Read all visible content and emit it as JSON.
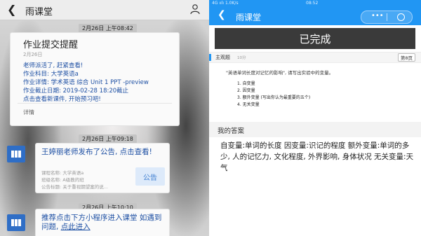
{
  "left": {
    "title": "雨课堂",
    "timestamps": [
      "2月26日 上午08:42",
      "2月26日 上午09:18",
      "2月26日 上午10:10"
    ],
    "reminder": {
      "title": "作业提交提醒",
      "date": "2月26日",
      "lines": [
        "老师派活了, 赶紧查看!",
        "作业科目: 大学英语a",
        "作业详情: 学术英语 综合 Unit 1 PPT -preview",
        "作业截止日期: 2019-02-28 18:20截止",
        "点击查看新课件, 开始预习吧!"
      ],
      "detail": "详情"
    },
    "announcement": {
      "title": "王婷丽老师发布了公告, 点击查看!",
      "lines": [
        "课程名称: 大学英语a",
        "班级名称: A级教的班",
        "公告标题: 关于重视期望案的说..."
      ],
      "badge": "公告"
    },
    "miniprogram": {
      "title": "推荐点击下方小程序进入课堂 如遇到问题,",
      "link": "点此进入"
    }
  },
  "right": {
    "status_left": "4G ıılı 1.0K/s",
    "status_right": "08:52",
    "title": "雨课堂",
    "completed": "已完成",
    "question_type": "主观题",
    "score": "10分",
    "question_number": "第8页",
    "question_text": "\"英语单词长度对记忆的影响\", 请写出实验中的变量。",
    "options": [
      "1. 自变量",
      "2. 因变量",
      "3. 额外变量 (写出你认为最重要的五个)",
      "4. 无关变量"
    ],
    "answer_header": "我的答案",
    "answer_text": "自变量:单词的长度 因变量:识记的程度 额外变量:单词的多少, 人的记忆力, 文化程度, 外界影响, 身体状况 无关变量:天气"
  },
  "colors": {
    "accent": "#2196f3",
    "link": "#1d4fa3",
    "completed_bg": "#3a3a3a"
  },
  "icons": [
    "back-arrow-icon",
    "person-icon",
    "avatar-icon",
    "more-dots-icon",
    "close-ring-icon"
  ]
}
